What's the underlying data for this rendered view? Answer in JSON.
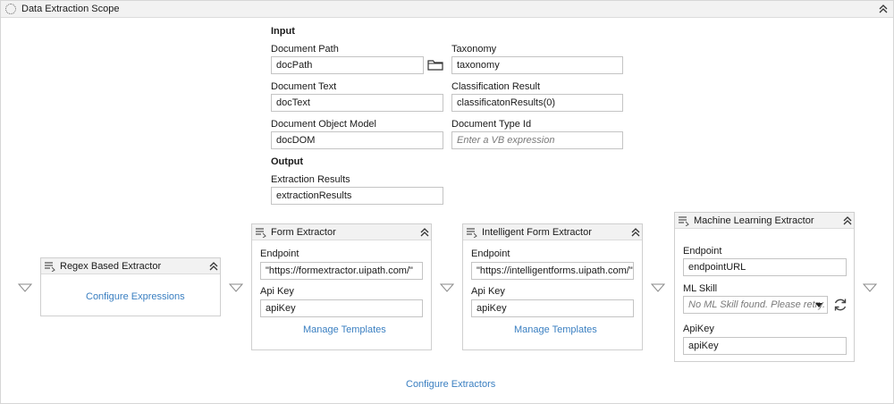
{
  "scope": {
    "title": "Data Extraction Scope",
    "input_label": "Input",
    "output_label": "Output",
    "fields": {
      "document_path": {
        "label": "Document Path",
        "value": "docPath"
      },
      "taxonomy": {
        "label": "Taxonomy",
        "value": "taxonomy"
      },
      "document_text": {
        "label": "Document Text",
        "value": "docText"
      },
      "classification_result": {
        "label": "Classification Result",
        "value": "classificatonResults(0)"
      },
      "document_object_model": {
        "label": "Document Object Model",
        "value": "docDOM"
      },
      "document_type_id": {
        "label": "Document Type Id",
        "placeholder": "Enter a VB expression"
      },
      "extraction_results": {
        "label": "Extraction Results",
        "value": "extractionResults"
      }
    },
    "configure_extractors": "Configure Extractors"
  },
  "extractors": {
    "regex": {
      "title": "Regex Based Extractor",
      "link": "Configure Expressions"
    },
    "form": {
      "title": "Form Extractor",
      "endpoint_label": "Endpoint",
      "endpoint_value": "\"https://formextractor.uipath.com/\"",
      "apikey_label": "Api Key",
      "apikey_value": "apiKey",
      "link": "Manage Templates"
    },
    "intelligent": {
      "title": "Intelligent Form Extractor",
      "endpoint_label": "Endpoint",
      "endpoint_value": "\"https://intelligentforms.uipath.com/\"",
      "apikey_label": "Api Key",
      "apikey_value": "apiKey",
      "link": "Manage Templates"
    },
    "ml": {
      "title": "Machine Learning Extractor",
      "endpoint_label": "Endpoint",
      "endpoint_value": "endpointURL",
      "skill_label": "ML Skill",
      "skill_placeholder": "No ML Skill found. Please retry.",
      "apikey_label": "ApiKey",
      "apikey_value": "apiKey"
    }
  },
  "icons": {
    "scope": "scope-icon",
    "collapse": "chevron-double-up-icon",
    "browse": "folder-icon",
    "drop": "drop-arrow-icon",
    "activity": "activity-icon",
    "refresh": "refresh-icon"
  },
  "colors": {
    "link": "#3a7fc1",
    "header_bg": "#f2f2f2",
    "border": "#cfcfcf"
  }
}
